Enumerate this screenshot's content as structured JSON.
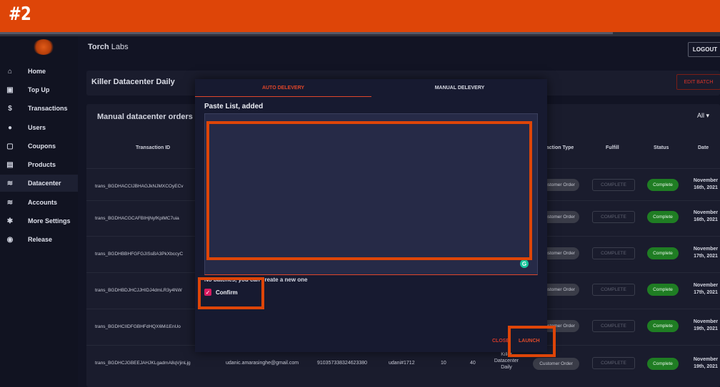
{
  "banner": {
    "title": "#2"
  },
  "sidebar": {
    "items": [
      {
        "label": "Home",
        "icon": "home-icon",
        "glyph": "⌂"
      },
      {
        "label": "Top Up",
        "icon": "wallet-icon",
        "glyph": "▣"
      },
      {
        "label": "Transactions",
        "icon": "dollar-icon",
        "glyph": "$"
      },
      {
        "label": "Users",
        "icon": "user-icon",
        "glyph": "●"
      },
      {
        "label": "Coupons",
        "icon": "coupon-icon",
        "glyph": "▢"
      },
      {
        "label": "Products",
        "icon": "briefcase-icon",
        "glyph": "▤"
      },
      {
        "label": "Datacenter",
        "icon": "wifi-icon",
        "glyph": "≋",
        "active": true
      },
      {
        "label": "Accounts",
        "icon": "wifi-icon",
        "glyph": "≋"
      },
      {
        "label": "More Settings",
        "icon": "gear-icon",
        "glyph": "✱"
      },
      {
        "label": "Release",
        "icon": "globe-icon",
        "glyph": "◉"
      }
    ]
  },
  "topbar": {
    "brand": "Torch",
    "brand_suffix": " Labs",
    "logout_label": "LOGOUT"
  },
  "batch": {
    "title": "Killer Datacenter Daily",
    "edit_label": "EDIT BATCH"
  },
  "orders": {
    "title": "Manual datacenter orders t",
    "filter": "All ▾",
    "columns": {
      "transaction_id": "Transaction ID",
      "type": "saction Type",
      "fulfill": "Fulfill",
      "status": "Status",
      "date": "Date"
    },
    "rows": [
      {
        "id": "trans_BGDHACCIJBHAGJkNJMXCOyECv",
        "type": "ustomer Order",
        "fulfill": "COMPLETE",
        "status": "Complete",
        "date_line1": "November",
        "date_line2": "16th, 2021"
      },
      {
        "id": "trans_BGDHACGCAFBIHjNyfKplMC7uia",
        "type": "ustomer Order",
        "fulfill": "COMPLETE",
        "status": "Complete",
        "date_line1": "November",
        "date_line2": "16th, 2021"
      },
      {
        "id": "trans_BGDHBBHFGFGJISsBA3PkXbccyC",
        "type": "ustomer Order",
        "fulfill": "COMPLETE",
        "status": "Complete",
        "date_line1": "November",
        "date_line2": "17th, 2021"
      },
      {
        "id": "trans_BGDHBDJHCJJHIDJ4dmLR3y4NW",
        "type": "ustomer Order",
        "fulfill": "COMPLETE",
        "status": "Complete",
        "date_line1": "November",
        "date_line2": "17th, 2021"
      },
      {
        "id": "trans_BGDHCIIDFGBHFdHQX6Mi1EnUo",
        "type": "ustomer Order",
        "fulfill": "COMPLETE",
        "status": "Complete",
        "date_line1": "November",
        "date_line2": "19th, 2021"
      },
      {
        "id": "trans_BGDHCJGBEEJAHJKLgadmA8qVjinLjg",
        "email": "udanic.amarasinghe@gmail.com",
        "number": "910357338324623380",
        "user": "udani#1712",
        "qty": "10",
        "amount": "40",
        "batch": "Killer Datacenter Daily",
        "batch_line1": "Killer",
        "batch_line2": "Datacenter",
        "batch_line3": "Daily",
        "type": "Customer Order",
        "fulfill": "COMPLETE",
        "status": "Complete",
        "date_line1": "November",
        "date_line2": "19th, 2021"
      }
    ]
  },
  "modal": {
    "tabs": {
      "auto": "AUTO DELEVERY",
      "manual": "MANUAL DELEVERY"
    },
    "paste_label": "Paste List, added",
    "paste_value": "",
    "no_batches_text": "No batches, you can create a new one",
    "confirm_label": "Confirm",
    "confirm_checked": true,
    "close_label": "CLOSE",
    "launch_label": "LAUNCH"
  },
  "colors": {
    "accent": "#de4508",
    "status_green": "#1f7d23",
    "checkbox": "#d81b60"
  }
}
